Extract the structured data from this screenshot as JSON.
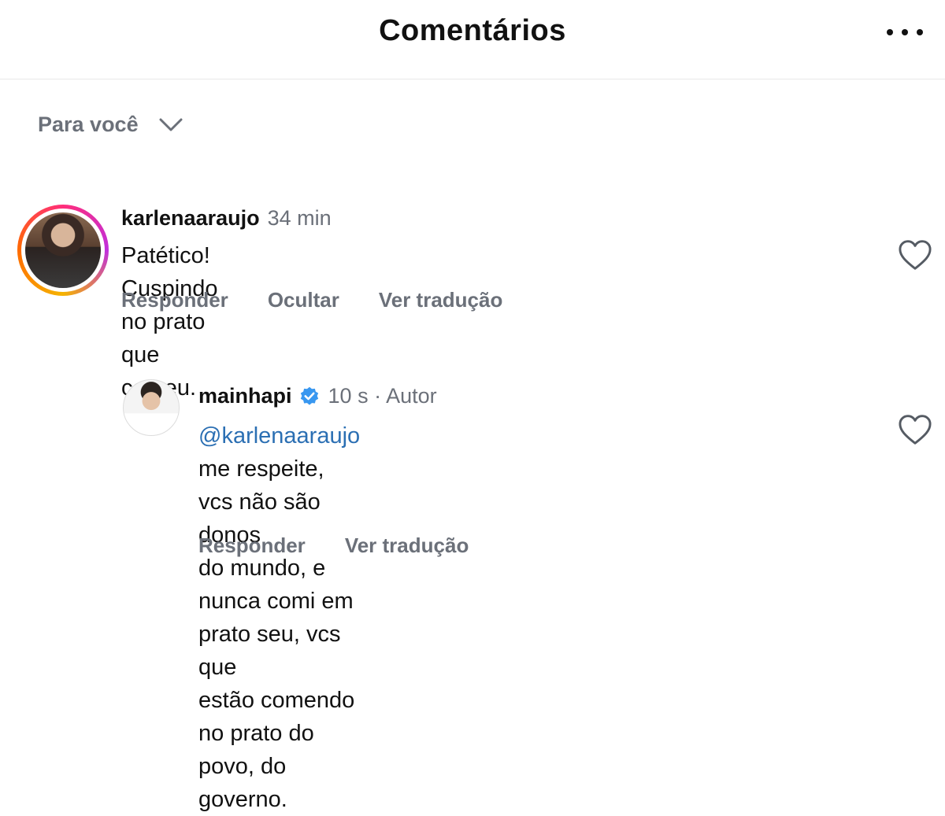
{
  "header": {
    "title": "Comentários",
    "more_icon": "more-horizontal-icon"
  },
  "filter": {
    "label": "Para você",
    "icon": "chevron-down-icon"
  },
  "comments": [
    {
      "username": "karlenaaraujo",
      "time": "34 min",
      "text": "Patético! Cuspindo no prato que comeu.",
      "actions": [
        "Responder",
        "Ocultar",
        "Ver tradução"
      ],
      "liked": false
    }
  ],
  "reply": {
    "username": "mainhapi",
    "verified": true,
    "time": "10 s · Autor",
    "mention": "@karlenaaraujo",
    "text_lines": [
      " me respeite, vcs não são donos",
      "do mundo, e nunca comi em prato seu, vcs que",
      "estão comendo no prato do povo, do governo."
    ],
    "actions": [
      "Responder",
      "Ver tradução"
    ],
    "liked": false
  },
  "colors": {
    "mention": "#2b6fb3",
    "verified": "#3897f0",
    "muted": "#6b7079"
  }
}
